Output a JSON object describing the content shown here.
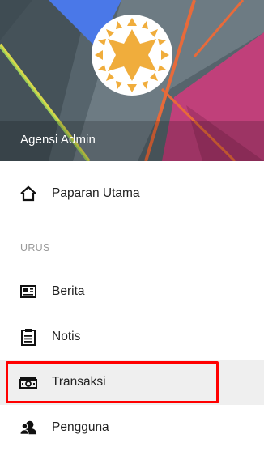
{
  "header": {
    "account_name": "Agensi Admin",
    "colors": {
      "bg": "#4a5860",
      "accent_pink": "#c0407a",
      "accent_orange": "#e86a3a",
      "accent_yellow": "#d7d84a",
      "accent_blue": "#4a78e8",
      "logo": "#f0ad3c"
    }
  },
  "nav": {
    "home_label": "Paparan Utama",
    "section_label": "URUS",
    "items": [
      {
        "label": "Berita",
        "icon": "newspaper-icon"
      },
      {
        "label": "Notis",
        "icon": "clipboard-icon"
      },
      {
        "label": "Transaksi",
        "icon": "money-icon",
        "selected": true
      },
      {
        "label": "Pengguna",
        "icon": "users-icon"
      }
    ]
  },
  "annotation": {
    "highlight_color": "#ff0000"
  }
}
